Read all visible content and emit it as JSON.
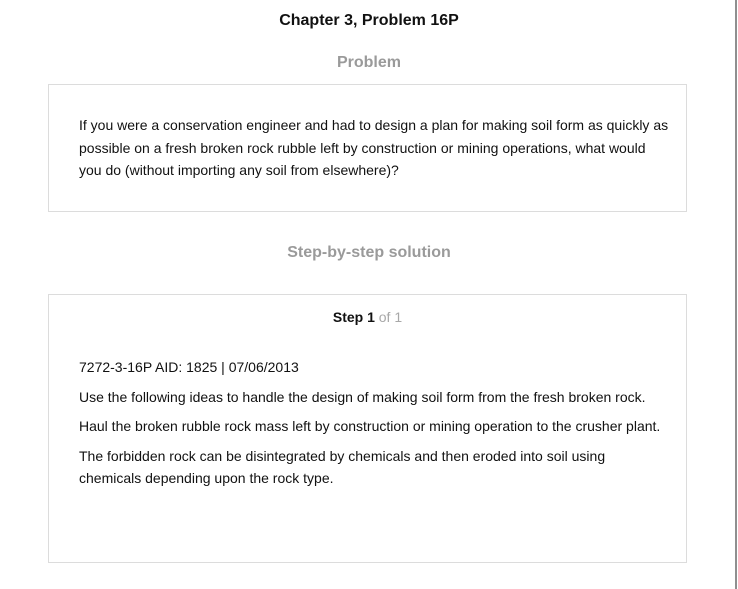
{
  "page": {
    "chapter_title": "Chapter 3, Problem 16P"
  },
  "problem": {
    "heading": "Problem",
    "text": "If you were a conservation engineer and had to design a plan for making soil form as quickly as possible on a fresh broken rock rubble left by construction or mining operations, what would you do (without importing any soil from elsewhere)?"
  },
  "solution": {
    "heading": "Step-by-step solution",
    "step_label": "Step 1",
    "step_of": "of 1",
    "paragraphs": [
      "7272-3-16P AID: 1825 | 07/06/2013",
      "Use the following ideas to handle the design of making soil form from the fresh broken rock.",
      "Haul the broken rubble rock mass left by construction or mining operation to the crusher plant.",
      "The forbidden rock can be disintegrated by chemicals and then eroded into soil using chemicals depending upon the rock type."
    ]
  }
}
